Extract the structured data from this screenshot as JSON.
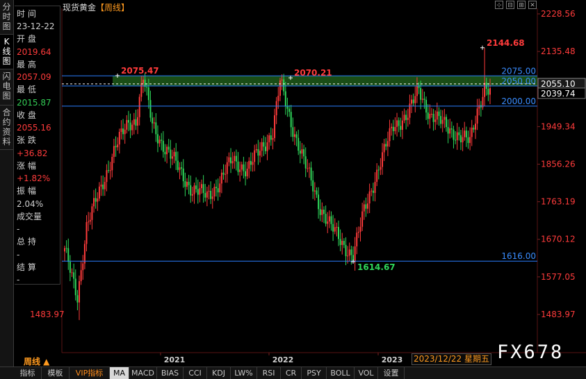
{
  "title": "现货黄金",
  "period_tag": "【周线】",
  "side_tabs": [
    {
      "label": "分时图",
      "active": false
    },
    {
      "label": "K线图",
      "active": true
    },
    {
      "label": "闪电图",
      "active": false
    },
    {
      "label": "合约资料",
      "active": false
    }
  ],
  "info": {
    "time_label": "时 间",
    "time_value": "23-12-22",
    "open_label": "开 盘",
    "open_value": "2019.64",
    "high_label": "最 高",
    "high_value": "2057.09",
    "low_label": "最 低",
    "low_value": "2015.87",
    "close_label": "收 盘",
    "close_value": "2055.16",
    "change_label": "张 跌",
    "change_value": "+36.82",
    "pct_label": "涨 幅",
    "pct_value": "+1.82%",
    "amp_label": "振 幅",
    "amp_value": "2.04%",
    "vol_label": "成交量",
    "vol_value": "-",
    "oi_label": "总 持",
    "oi_value": "-",
    "settle_label": "结 算",
    "settle_value": "-"
  },
  "window_controls": [
    "⊹",
    "⊟",
    "⊞",
    "✕"
  ],
  "period_label": "周线 ▲",
  "date_box": "2023/12/22 星期五",
  "watermark": "FX678",
  "bottom_tabs": [
    "指标",
    "模板",
    "VIP指标",
    "MA",
    "MACD",
    "BIAS",
    "CCI",
    "KDJ",
    "LW%",
    "RSI",
    "CR",
    "PSY",
    "BOLL",
    "VOL",
    "设置"
  ],
  "colors": {
    "up": "#ff3b3b",
    "down": "#2fd75a",
    "line": "#2a7fff",
    "zone": "#1f5a1a"
  },
  "chart_data": {
    "type": "candlestick",
    "yaxis_ticks": [
      "2228.56",
      "2135.48",
      "2055.10",
      "2039.74",
      "1949.34",
      "1856.26",
      "1763.19",
      "1670.12",
      "1577.05",
      "1483.97"
    ],
    "x_labels": [
      "2021",
      "2022",
      "2023"
    ],
    "left_min_label": "1483.97",
    "levels": [
      {
        "label": "2075.00",
        "value": 2075.0
      },
      {
        "label": "2050.00",
        "value": 2050.0
      },
      {
        "label": "2000.00",
        "value": 2000.0
      },
      {
        "label": "1616.00",
        "value": 1616.0
      }
    ],
    "annotations": [
      {
        "text": "2075.47",
        "value": 2075.47,
        "kind": "high"
      },
      {
        "text": "2070.21",
        "value": 2070.21,
        "kind": "high"
      },
      {
        "text": "1614.67",
        "value": 1614.67,
        "kind": "low"
      },
      {
        "text": "2144.68",
        "value": 2144.68,
        "kind": "high"
      }
    ],
    "current_price": "2055.10",
    "last_ma": "2039.74",
    "ylim": [
      1460,
      2245
    ]
  }
}
